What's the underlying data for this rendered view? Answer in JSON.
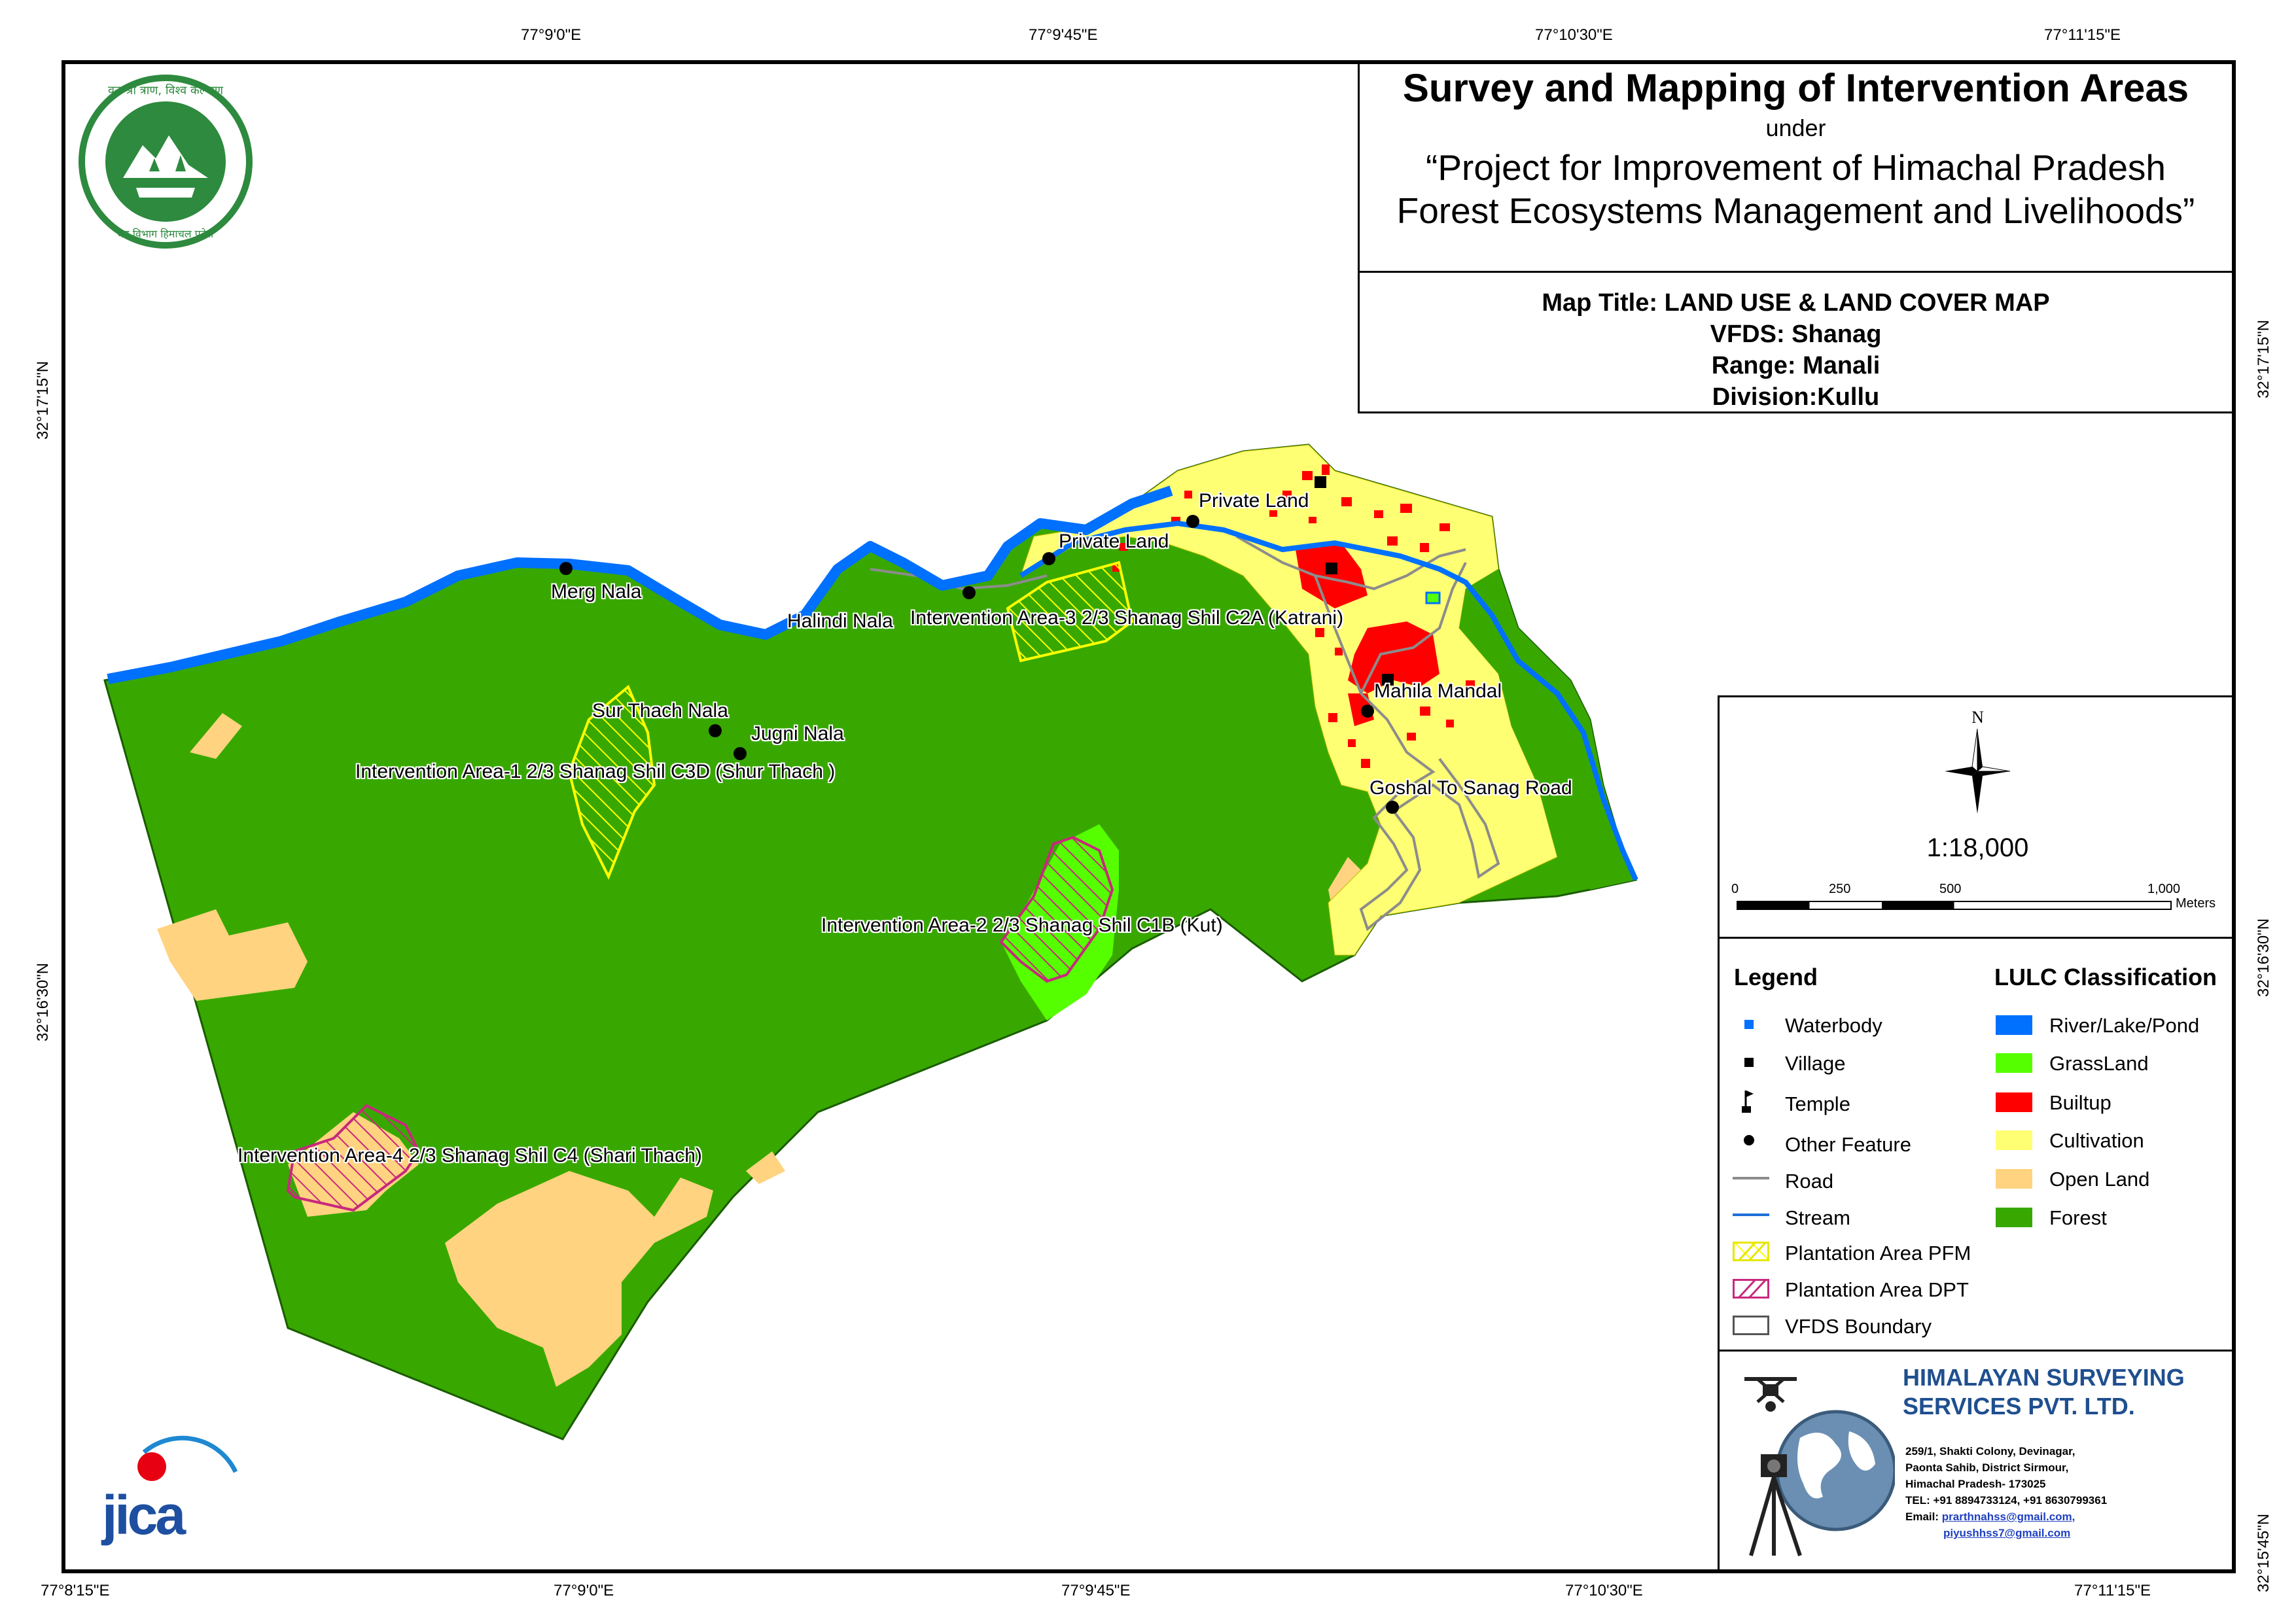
{
  "title": {
    "main": "Survey and Mapping of Intervention Areas",
    "under": "under",
    "project_line1": "“Project for Improvement of Himachal Pradesh",
    "project_line2": "Forest Ecosystems Management and Livelihoods”"
  },
  "map_info": {
    "map_title": "Map Title: LAND USE & LAND COVER MAP",
    "vfds": "VFDS: Shanag",
    "range": "Range: Manali",
    "division": "Division:Kullu"
  },
  "coordinates": {
    "top": [
      "77°9'0\"E",
      "77°9'45\"E",
      "77°10'30\"E",
      "77°11'15\"E"
    ],
    "bottom": [
      "77°8'15\"E",
      "77°9'0\"E",
      "77°9'45\"E",
      "77°10'30\"E",
      "77°11'15\"E"
    ],
    "left": [
      "32°17'15\"N",
      "32°16'30\"N"
    ],
    "right": [
      "32°17'15\"N",
      "32°16'30\"N",
      "32°15'45\"N"
    ]
  },
  "north_arrow": {
    "label": "N"
  },
  "scale": {
    "ratio": "1:18,000",
    "ticks": [
      "0",
      "250",
      "500",
      "1,000"
    ],
    "unit": "Meters"
  },
  "legend": {
    "heading": "Legend",
    "items": [
      "Waterbody",
      "Village",
      "Temple",
      "Other Feature",
      "Road",
      "Stream",
      "Plantation Area PFM",
      "Plantation Area DPT",
      "VFDS Boundary"
    ]
  },
  "lulc": {
    "heading": "LULC Classification",
    "items": [
      {
        "label": "River/Lake/Pond",
        "color": "#0070ff"
      },
      {
        "label": "GrassLand",
        "color": "#55ff00"
      },
      {
        "label": "Builtup",
        "color": "#ff0000"
      },
      {
        "label": "Cultivation",
        "color": "#ffff73"
      },
      {
        "label": "Open Land",
        "color": "#ffd37f"
      },
      {
        "label": "Forest",
        "color": "#38a800"
      }
    ]
  },
  "map_labels": {
    "merg_nala": "Merg Nala",
    "halindi_nala": "Halindi Nala",
    "intervention_3": "Intervention Area-3 2/3 Shanag Shil C2A (Katrani)",
    "private_land_1": "Private Land",
    "private_land_2": "Private Land",
    "sur_thach_nala": "Sur Thach Nala",
    "jugni_nala": "Jugni Nala",
    "intervention_1": "Intervention Area-1 2/3 Shanag Shil C3D (Shur Thach )",
    "mahila_mandal": "Mahila Mandal",
    "goshal_road": "Goshal To Sanag Road",
    "intervention_2": "Intervention Area-2 2/3  Shanag Shil  C1B (Kut)",
    "intervention_4": "Intervention Area-4 2/3 Shanag Shil C4 (Shari Thach)"
  },
  "company": {
    "name_line1": "HIMALAYAN SURVEYING",
    "name_line2": "SERVICES PVT. LTD.",
    "addr1": "259/1, Shakti Colony, Devinagar,",
    "addr2": "Paonta Sahib, District Sirmour,",
    "addr3": "Himachal Pradesh- 173025",
    "tel": "TEL: +91 8894733124, +91 8630799361",
    "email_label": "Email:",
    "email1": "prarthnahss@gmail.com,",
    "email2": "piyushhss7@gmail.com"
  },
  "logos": {
    "forest_dept_top": "वन श्री त्राण, विश्व कल्याण",
    "forest_dept_bottom": "वन विभाग हिमाचल प्रदेश",
    "jica": "JICA"
  }
}
